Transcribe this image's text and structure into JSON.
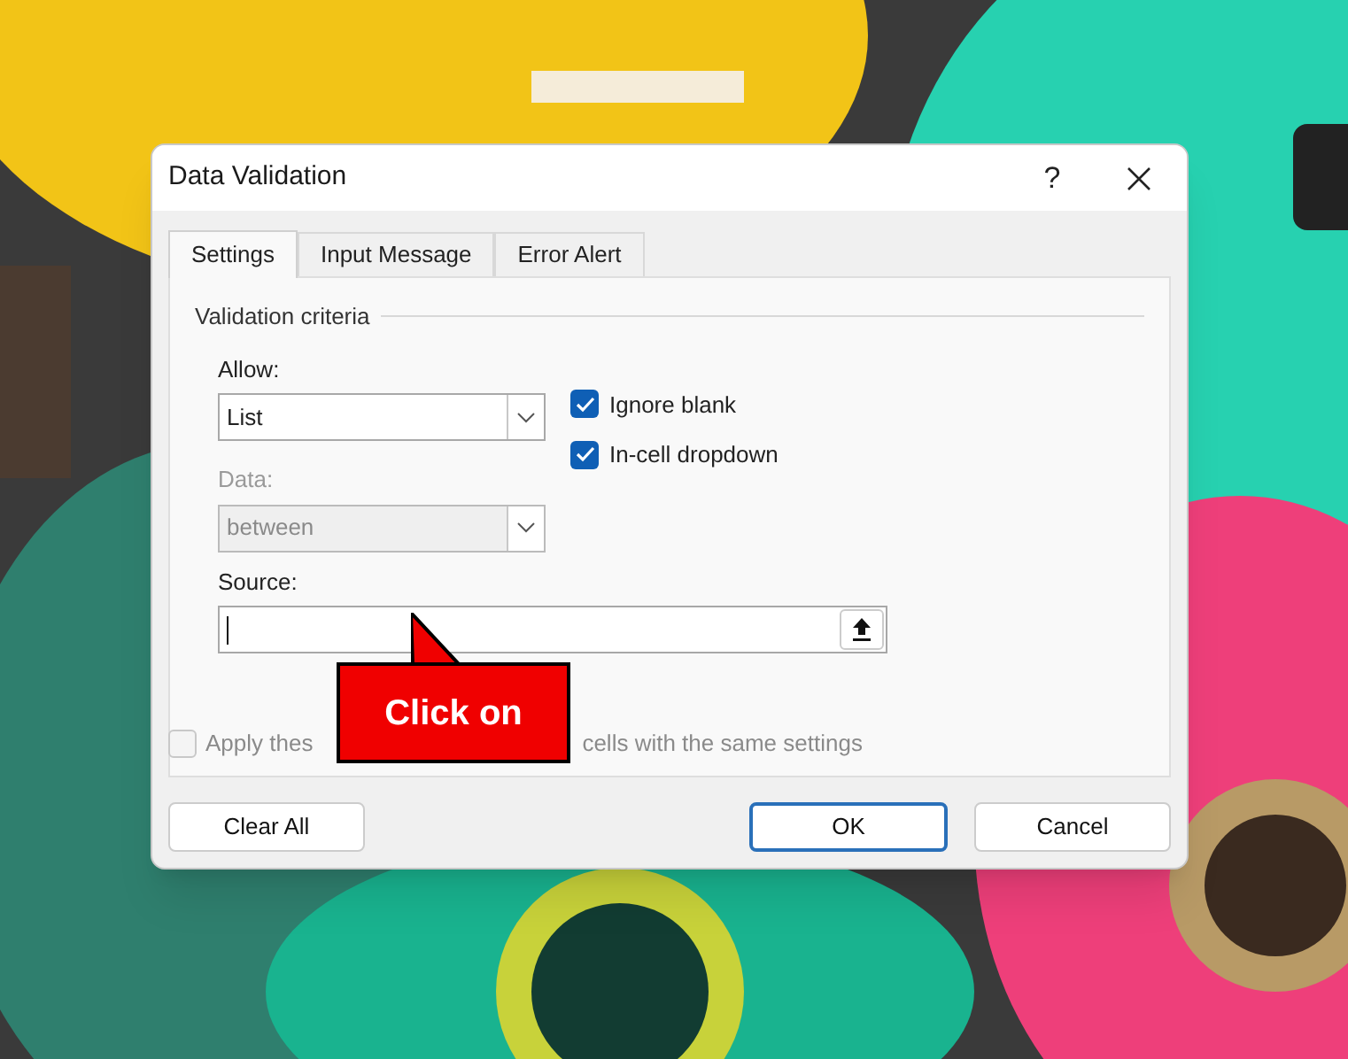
{
  "dialog": {
    "title": "Data Validation",
    "help": "?",
    "tabs": [
      {
        "label": "Settings",
        "selected": true
      },
      {
        "label": "Input Message",
        "selected": false
      },
      {
        "label": "Error Alert",
        "selected": false
      }
    ],
    "group_title": "Validation criteria",
    "allow": {
      "label": "Allow:",
      "value": "List",
      "disabled": false
    },
    "data": {
      "label": "Data:",
      "value": "between",
      "disabled": true
    },
    "options": [
      {
        "label": "Ignore blank",
        "checked": true
      },
      {
        "label": "In-cell dropdown",
        "checked": true
      }
    ],
    "source": {
      "label": "Source:"
    },
    "apply": {
      "checked": false,
      "disabled": true,
      "text_before": "Apply thes",
      "text_after": "cells with the same settings"
    },
    "buttons": [
      {
        "label": "Clear All",
        "default": false
      },
      {
        "label": "OK",
        "default": true
      },
      {
        "label": "Cancel",
        "default": false
      }
    ]
  },
  "callout": {
    "text": "Click on"
  }
}
